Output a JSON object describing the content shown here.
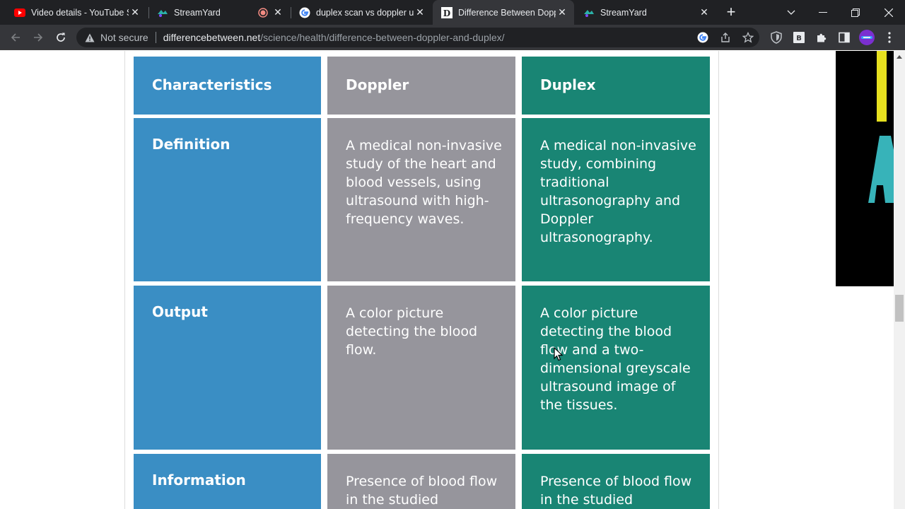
{
  "browser": {
    "tabs": [
      {
        "title": "Video details - YouTube Studio",
        "icon": "youtube-icon",
        "active": false
      },
      {
        "title": "StreamYard",
        "icon": "streamyard-icon",
        "active": false
      },
      {
        "title": "duplex scan vs doppler ultrasound",
        "icon": "google-icon",
        "active": false
      },
      {
        "title": "Difference Between Doppler and Duplex",
        "icon": "differencebetween-icon",
        "active": true
      },
      {
        "title": "StreamYard",
        "icon": "streamyard-icon",
        "active": false
      }
    ],
    "new_tab_label": "+",
    "address": {
      "security_label": "Not secure",
      "host": "differencebetween.net",
      "path": "/science/health/difference-between-doppler-and-duplex/"
    }
  },
  "colors": {
    "characteristics_column": "#3a8ec4",
    "doppler_column": "#96959c",
    "duplex_column": "#198574"
  },
  "table": {
    "headers": [
      "Characteristics",
      "Doppler",
      "Duplex"
    ],
    "rows": [
      {
        "label": "Definition",
        "doppler": "A medical non-invasive study of the heart and blood vessels, using ultrasound with high-frequency waves.",
        "duplex": "A medical non-invasive study, combining traditional ultrasonography and Doppler ultrasonography."
      },
      {
        "label": "Output",
        "doppler": "A color picture detecting the blood flow.",
        "duplex": "A color picture detecting the blood flow and a two-dimensional greyscale ultrasound image of the tissues."
      },
      {
        "label": "Information",
        "doppler": "Presence of blood flow in the studied",
        "duplex": "Presence of blood flow in the studied"
      }
    ]
  }
}
